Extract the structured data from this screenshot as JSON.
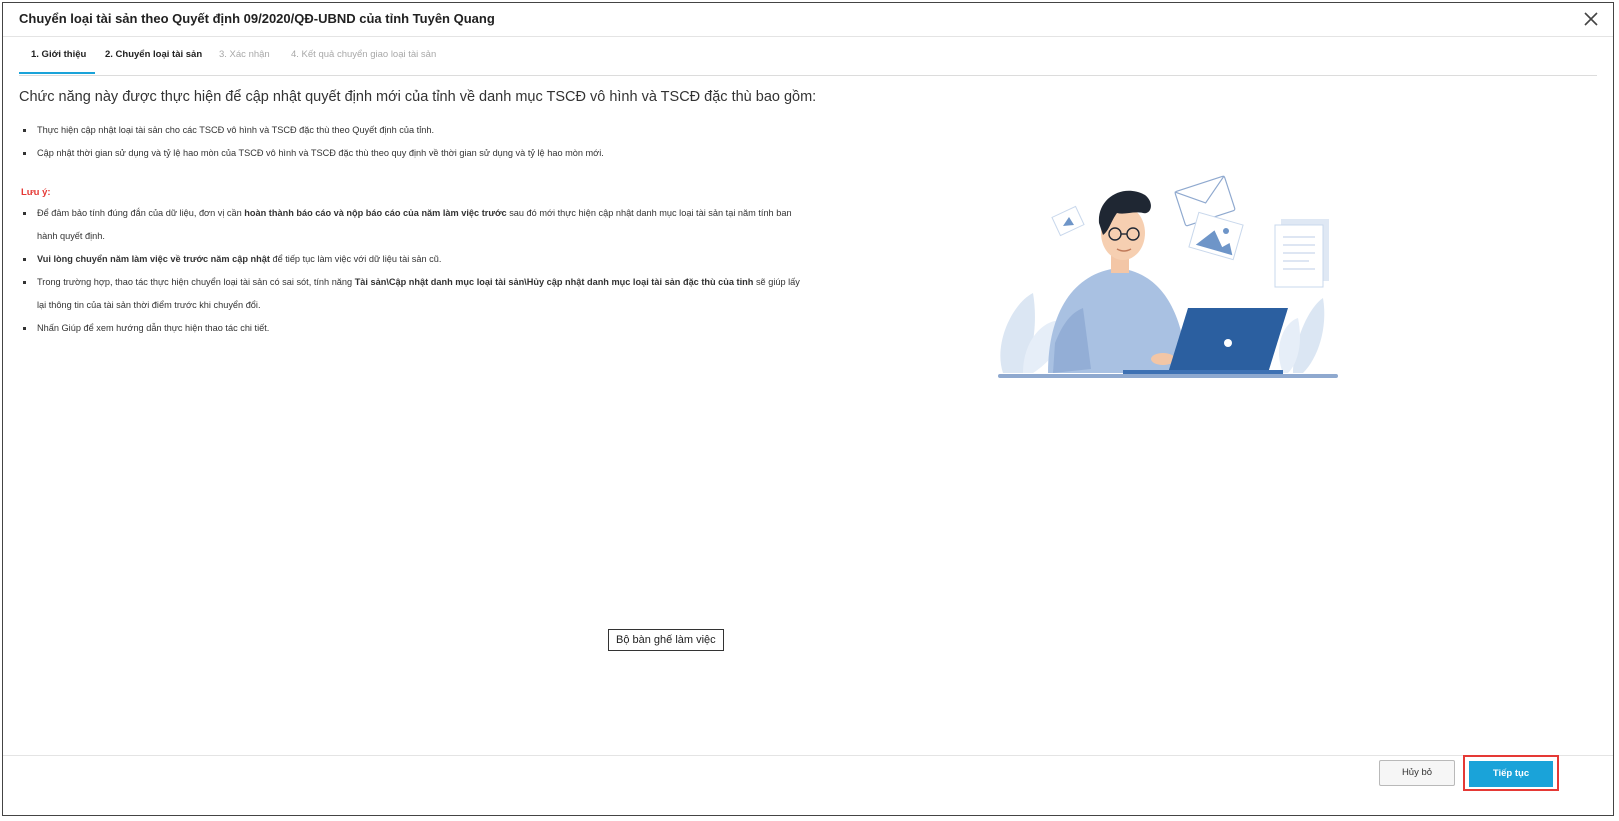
{
  "dialog": {
    "title": "Chuyển loại tài sản theo Quyết định 09/2020/QĐ-UBND của tỉnh Tuyên Quang",
    "close_icon": "close-icon"
  },
  "tabs": [
    {
      "label": "1. Giới thiệu",
      "state": "active"
    },
    {
      "label": "2. Chuyển loại tài sản",
      "state": "enabled"
    },
    {
      "label": "3. Xác nhận",
      "state": "disabled"
    },
    {
      "label": "4. Kết quả chuyển giao loại tài sản",
      "state": "disabled"
    }
  ],
  "content": {
    "heading": "Chức năng này được thực hiện để cập nhật quyết định mới của tỉnh về danh mục TSCĐ vô hình và TSCĐ đặc thù bao gồm:",
    "intro_bullets": [
      "Thực hiện cập nhật loại tài sản cho các TSCĐ vô hình và TSCĐ đặc thù theo Quyết định của tỉnh.",
      "Cập nhật thời gian sử dụng và tỷ lệ hao mòn của TSCĐ vô hình và TSCĐ đặc thù theo quy định về thời gian sử dụng và tỷ lệ hao mòn mới."
    ],
    "note_label": "Lưu ý:",
    "notes": {
      "n1_a": "Để đảm bảo tính đúng đắn của dữ liệu, đơn vị cần ",
      "n1_b": "hoàn thành báo cáo và nộp báo cáo của năm làm việc trước",
      "n1_c": " sau đó mới thực hiện cập nhật danh mục loại tài sản tại năm tính ban hành quyết định.",
      "n2_a": "Vui lòng chuyển năm làm việc về trước năm cập nhật",
      "n2_b": " để tiếp tục làm việc với dữ liệu tài sản cũ.",
      "n3_a": "Trong trường hợp, thao tác thực hiện chuyển loại tài sản có sai sót, tính năng ",
      "n3_b": "Tài sản\\Cập nhật danh mục loại tài sản\\Hủy cập nhật danh mục loại tài sản đặc thù của tỉnh",
      "n3_c": " sẽ giúp lấy lại thông tin của tài sản thời điểm trước khi chuyển đổi.",
      "n4": "Nhấn Giúp để xem hướng dẫn thực hiện thao tác chi tiết."
    }
  },
  "tooltip": "Bộ bàn ghế làm việc",
  "footer": {
    "cancel_label": "Hủy bỏ",
    "next_label": "Tiếp tục"
  },
  "colors": {
    "accent": "#1aa3d9",
    "warning_red": "#e53935",
    "illustration_blue": "#2b5fa0"
  }
}
